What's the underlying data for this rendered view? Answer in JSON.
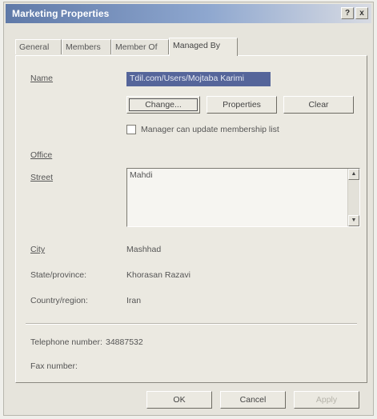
{
  "window": {
    "title": "Marketing Properties",
    "help_glyph": "?",
    "close_glyph": "x"
  },
  "tabs": [
    {
      "label": "General"
    },
    {
      "label": "Members"
    },
    {
      "label": "Member Of"
    },
    {
      "label": "Managed By",
      "active": true
    }
  ],
  "form": {
    "name_label": "Name",
    "name_value": "Tdil.com/Users/Mojtaba Karimi",
    "change_button": "Change...",
    "properties_button": "Properties",
    "clear_button": "Clear",
    "manager_checkbox_label": "Manager can update membership list",
    "manager_checkbox_checked": false,
    "office_label": "Office",
    "office_value": "",
    "street_label": "Street",
    "street_value": "Mahdi",
    "city_label": "City",
    "city_value": "Mashhad",
    "state_label": "State/province:",
    "state_value": "Khorasan Razavi",
    "country_label": "Country/region:",
    "country_value": "Iran",
    "telephone_label": "Telephone number:",
    "telephone_value": "34887532",
    "fax_label": "Fax number:",
    "fax_value": ""
  },
  "footer": {
    "ok_button": "OK",
    "cancel_button": "Cancel",
    "apply_button": "Apply"
  },
  "icons": {
    "scroll_up": "up-arrow-icon",
    "scroll_down": "down-arrow-icon"
  }
}
